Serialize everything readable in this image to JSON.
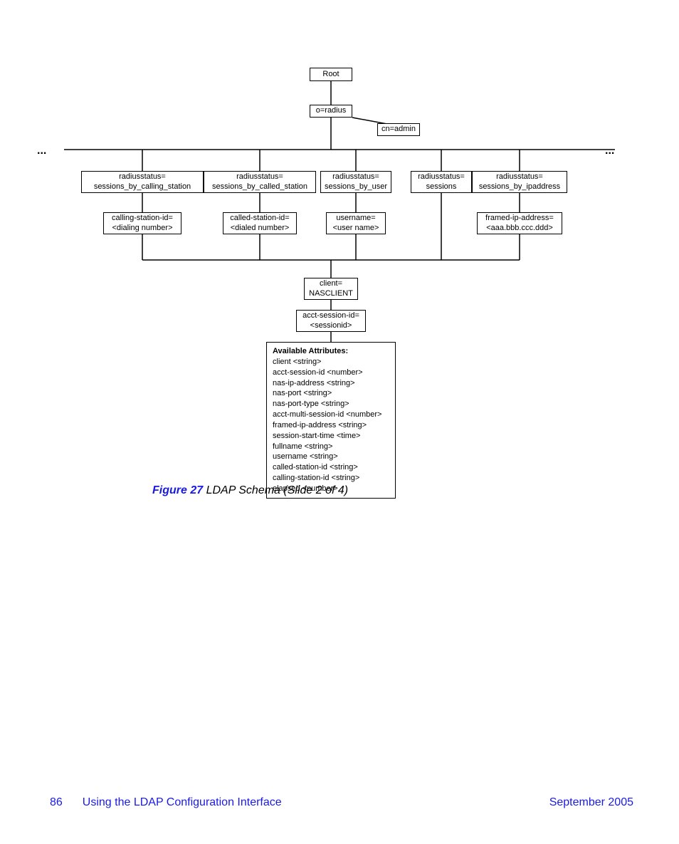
{
  "diagram": {
    "root": "Root",
    "oradius": "o=radius",
    "cnadmin": "cn=admin",
    "dots": "...",
    "rs1_l1": "radiusstatus=",
    "rs1_l2": "sessions_by_calling_station",
    "rs2_l1": "radiusstatus=",
    "rs2_l2": "sessions_by_called_station",
    "rs3_l1": "radiusstatus=",
    "rs3_l2": "sessions_by_user",
    "rs4_l1": "radiusstatus=",
    "rs4_l2": "sessions",
    "rs5_l1": "radiusstatus=",
    "rs5_l2": "sessions_by_ipaddress",
    "c1_l1": "calling-station-id=",
    "c1_l2": "<dialing number>",
    "c2_l1": "called-station-id=",
    "c2_l2": "<dialed number>",
    "c3_l1": "username=",
    "c3_l2": "<user name>",
    "c4_l1": "framed-ip-address=",
    "c4_l2": "<aaa.bbb.ccc.ddd>",
    "client_l1": "client=",
    "client_l2": "NASCLIENT",
    "sess_l1": "acct-session-id=",
    "sess_l2": "<sessionid>",
    "attrs_title": "Available Attributes:",
    "attrs": [
      "client <string>",
      "acct-session-id <number>",
      "nas-ip-address <string>",
      "nas-port <string>",
      "nas-port-type <string>",
      "acct-multi-session-id <number>",
      "framed-ip-address <string>",
      "session-start-time <time>",
      "fullname <string>",
      "username <string>",
      "called-station-id <string>",
      "calling-station-id <string>",
      "elapsed <number>"
    ]
  },
  "caption": {
    "fig": "Figure 27",
    "title": "LDAP Schema (Slide 2 of 4)"
  },
  "footer": {
    "page": "86",
    "chapter": "Using the LDAP Configuration Interface",
    "date": "September 2005"
  }
}
